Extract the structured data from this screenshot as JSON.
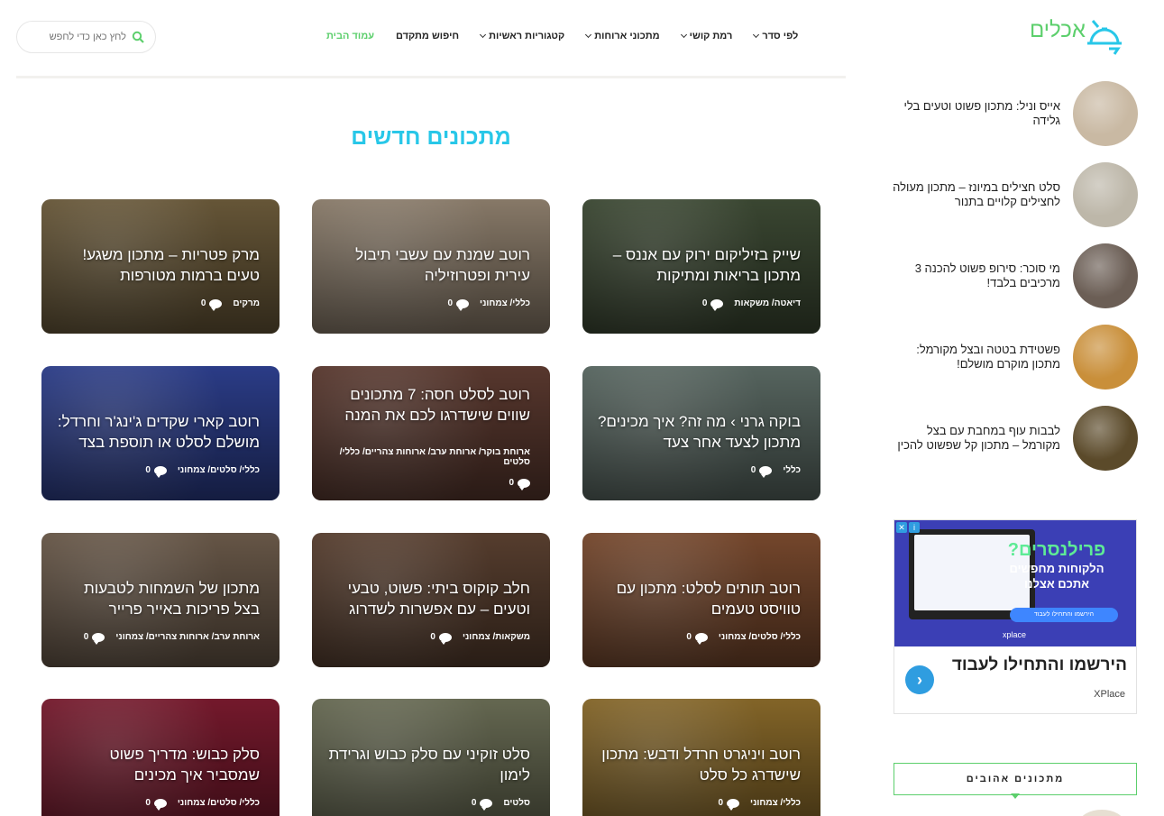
{
  "header": {
    "logo_text": "אכלים",
    "search_placeholder": "לחץ כאן כדי לחפש",
    "nav": [
      {
        "label": "עמוד הבית",
        "dropdown": false,
        "active": true
      },
      {
        "label": "חיפוש מתקדם",
        "dropdown": false,
        "active": false
      },
      {
        "label": "קטגוריות ראשיות",
        "dropdown": true,
        "active": false
      },
      {
        "label": "מתכוני ארוחות",
        "dropdown": true,
        "active": false
      },
      {
        "label": "רמת קושי",
        "dropdown": true,
        "active": false
      },
      {
        "label": "לפי סדר",
        "dropdown": true,
        "active": false
      }
    ]
  },
  "main": {
    "section_title": "מתכונים חדשים",
    "cards": [
      {
        "title": "שייק בזיליקום ירוק עם אננס – מתכון בריאות ומתיקות",
        "categories": "דיאטה/ משקאות",
        "comments": "0",
        "color": "#3d4a34"
      },
      {
        "title": "רוטב שמנת עם עשבי תיבול עירית ופטרוזיליה",
        "categories": "כללי/ צמחוני",
        "comments": "0",
        "color": "#8e7f6d"
      },
      {
        "title": "מרק פטריות – מתכון משגע! טעים ברמות מטורפות",
        "categories": "מרקים",
        "comments": "0",
        "color": "#6b5a3a"
      },
      {
        "title": "בוקה גרני › מה זה? איך מכינים? מתכון לצעד אחר צעד",
        "categories": "כללי",
        "comments": "0",
        "color": "#5b6a64"
      },
      {
        "title": "רוטב לסלט חסה: 7 מתכונים שווים שישדרגו לכם את המנה",
        "categories": "ארוחת בוקר/ ארוחת ערב/ ארוחות צהריים/ כללי/ סלטים",
        "comments": "0",
        "color": "#5c3a30"
      },
      {
        "title": "רוטב קארי שקדים ג'ינג'ר וחרדל: מושלם לסלט או תוספת בצד",
        "categories": "כללי/ סלטים/ צמחוני",
        "comments": "0",
        "color": "#2d3f8e"
      },
      {
        "title": "רוטב תותים לסלט: מתכון עם טוויסט טעמים",
        "categories": "כללי/ סלטים/ צמחוני",
        "comments": "0",
        "color": "#7a4a2e"
      },
      {
        "title": "חלב קוקוס ביתי: פשוט, טבעי וטעים – עם אפשרות לשדרוג",
        "categories": "משקאות/ צמחוני",
        "comments": "0",
        "color": "#5a4030"
      },
      {
        "title": "מתכון של השמחות לטבעות בצל פריכות באייר פרייר",
        "categories": "ארוחת ערב/ ארוחות צהריים/ צמחוני",
        "comments": "0",
        "color": "#6b5a4a"
      },
      {
        "title": "רוטב ויניגרט חרדל ודבש: מתכון שישדרג כל סלט",
        "categories": "כללי/ צמחוני",
        "comments": "0",
        "color": "#8a6a2a"
      },
      {
        "title": "סלט זוקיני עם סלק כבוש וגרידת לימון",
        "categories": "סלטים",
        "comments": "0",
        "color": "#6a6d55"
      },
      {
        "title": "סלק כבוש: מדריך פשוט שמסביר איך מכינים",
        "categories": "כללי/ סלטים/ צמחוני",
        "comments": "0",
        "color": "#7a1a2e"
      }
    ]
  },
  "sidebar": {
    "recent": [
      {
        "title": "אייס וניל: מתכון פשוט וטעים בלי גלידה",
        "color": "#c9b9a3"
      },
      {
        "title": "סלט חצילים במיונז – מתכון מעולה לחצילים קלויים בתנור",
        "color": "#bdb7a9"
      },
      {
        "title": "מי סוכר: סירופ פשוט להכנה 3 מרכיבים בלבד!",
        "color": "#6b5e55"
      },
      {
        "title": "פשטידת בטטה ובצל מקורמל: מתכון מוקרם מושלם!",
        "color": "#c98f3a"
      },
      {
        "title": "לבבות עוף במחבת עם בצל מקורמל – מתכון קל שפשוט להכין",
        "color": "#5b4a2a"
      }
    ],
    "ad": {
      "title_main": "פרילנסרים?",
      "title_lines": "הלקוחות מחפשים אתכם אצלנו",
      "cta": "הירשמו והתחילו לעבוד",
      "brand_small": "xplace",
      "headline": "הירשמו והתחילו לעבוד",
      "advertiser": "XPlace"
    },
    "favorites_title": "מתכונים אהובים"
  },
  "colors": {
    "brand_green": "#5ccf6c",
    "title_cyan": "#28c7e8",
    "ad_blue": "#3b3fb5"
  }
}
